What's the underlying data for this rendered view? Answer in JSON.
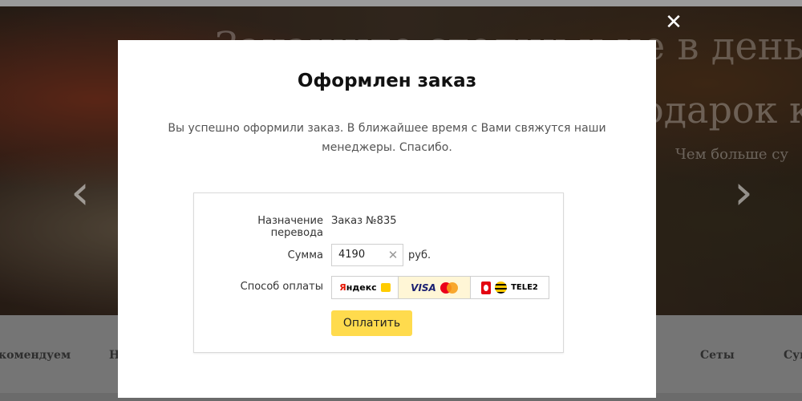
{
  "background": {
    "hero_title": "Закажите столик и не в день р",
    "hero_line2": "одарок к",
    "hero_line3": "Чем больше су",
    "categories": [
      {
        "label": "комендуем"
      },
      {
        "label": "Н"
      },
      {
        "label": "Сеты"
      },
      {
        "label": "Суп"
      }
    ]
  },
  "modal": {
    "title": "Оформлен заказ",
    "message": "Вы успешно оформили заказ. В ближайшее время с Вами свяжутся наши менеджеры. Спасибо.",
    "close_glyph": "✕",
    "form": {
      "purpose_label": "Назначение перевода",
      "purpose_value": "Заказ №835",
      "amount_label": "Сумма",
      "amount_value": "4190",
      "currency": "руб.",
      "method_label": "Способ оплаты",
      "methods": {
        "yandex": {
          "label_first": "Я",
          "label_rest": "ндекс"
        },
        "card": {
          "label": "VISA"
        },
        "mobile": {
          "label": "TELE2"
        }
      },
      "selected_method": "card",
      "pay_button": "Оплатить"
    }
  },
  "colors": {
    "accent_button": "#ffdb4d",
    "selected_method_bg": "#fff6d6",
    "visa_blue": "#1a1f71"
  }
}
